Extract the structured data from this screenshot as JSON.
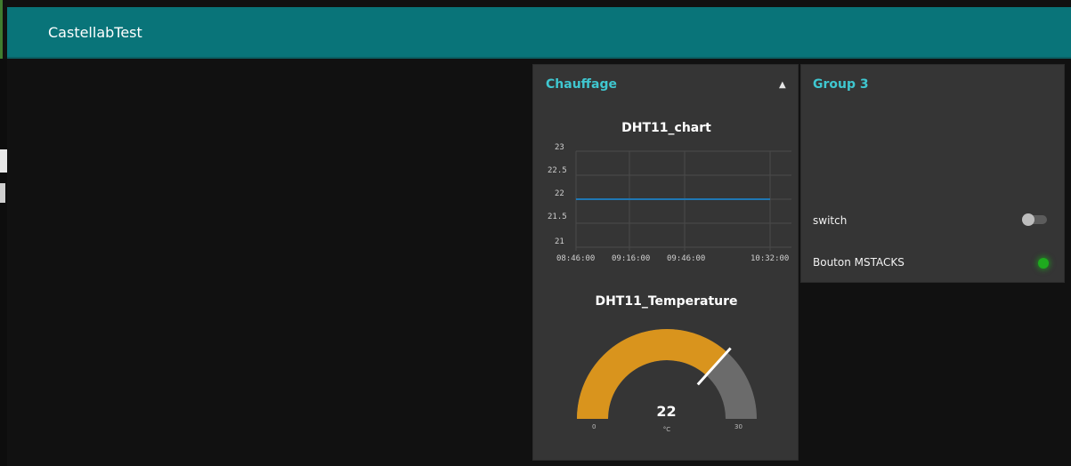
{
  "app": {
    "title": "CastellabTest"
  },
  "groups": {
    "chauffage": {
      "title": "Chauffage",
      "collapse_icon": "caret-up-icon",
      "chart": {
        "title": "DHT11_chart",
        "y_ticks": [
          "23",
          "22.5",
          "22",
          "21.5",
          "21"
        ],
        "x_ticks": [
          "08:46:00",
          "09:16:00",
          "09:46:00",
          "10:32:00"
        ]
      },
      "gauge": {
        "title": "DHT11_Temperature",
        "value": "22",
        "unit": "°C",
        "min": "0",
        "max": "30",
        "fill_color": "#d9941d",
        "rest_color": "#6b6b6b"
      }
    },
    "group3": {
      "title": "Group 3",
      "switch": {
        "label": "switch",
        "state": "off"
      },
      "led": {
        "label": "Bouton MSTACKS",
        "color": "#1eaa1e"
      }
    }
  },
  "chart_data": {
    "type": "line",
    "title": "DHT11_chart",
    "xlabel": "",
    "ylabel": "",
    "ylim": [
      21,
      23
    ],
    "x": [
      "08:46:00",
      "10:32:00"
    ],
    "series": [
      {
        "values": [
          22,
          22
        ],
        "color": "#1f77b4"
      }
    ],
    "grid": true
  }
}
